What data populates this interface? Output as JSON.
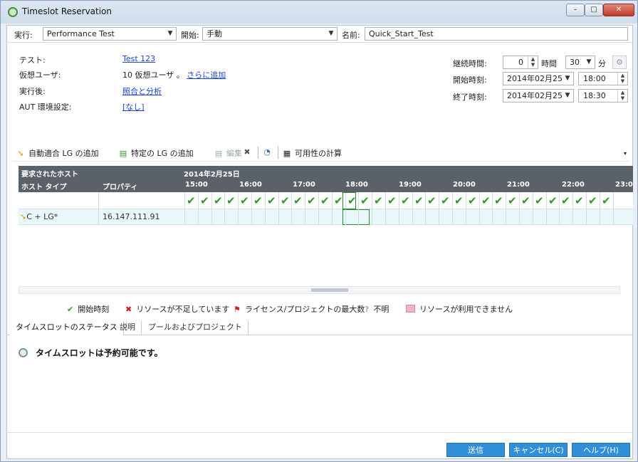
{
  "window": {
    "title": "Timeslot Reservation",
    "min": "–",
    "max": "□",
    "close": "✕"
  },
  "top": {
    "run_label": "実行:",
    "run_value": "Performance Test",
    "start_label": "開始:",
    "start_value": "手動",
    "name_label": "名前:",
    "name_value": "Quick_Start_Test"
  },
  "info": {
    "test_label": "テスト:",
    "test_value": "Test 123",
    "vusers_label": "仮想ユーザ:",
    "vusers_value": "10 仮想ユーザ 。",
    "vusers_link": "さらに追加",
    "after_label": "実行後:",
    "after_value": "照合と分析",
    "aut_label": "AUT 環境設定:",
    "aut_value": "[なし]"
  },
  "timing": {
    "duration_label": "継続時間:",
    "hours_value": "0",
    "hours_unit": "時間",
    "minutes_value": "30",
    "minutes_unit": "分",
    "start_label": "開始時刻:",
    "start_date": "2014年02月25",
    "start_time": "18:00",
    "end_label": "終了時刻:",
    "end_date": "2014年02月25",
    "end_time": "18:30"
  },
  "toolbar": {
    "auto_lg": "自動適合 LG の追加",
    "specific_lg": "特定の LG の追加",
    "edit": "編集",
    "calc": "可用性の計算"
  },
  "grid": {
    "requested_hosts": "要求されたホスト",
    "date": "2014年2月25日",
    "host_type": "ホスト タイプ",
    "properties": "プロパティ",
    "times": [
      "15:00",
      "16:00",
      "17:00",
      "18:00",
      "19:00",
      "20:00",
      "21:00",
      "22:00",
      "23:0"
    ],
    "host_name": "C + LG*",
    "host_ip": "16.147.111.91",
    "check": "✔"
  },
  "legend": {
    "start": "開始時刻",
    "lack": "リソースが不足しています",
    "license": "ライセンス/プロジェクトの最大数",
    "unknown": "不明",
    "unavailable": "リソースが利用できません"
  },
  "tabs": [
    "タイムスロットのステータス",
    "説明",
    "プールおよびプロジェクト"
  ],
  "status": {
    "message": "タイムスロットは予約可能です。"
  },
  "buttons": {
    "submit": "送信",
    "cancel": "キャンセル(C)",
    "help": "ヘルプ(H)"
  },
  "colors": {
    "accent_button": "#2f8fd8",
    "grid_header": "#5b6169",
    "check_green": "#2f9a2a",
    "host_row": "#e8f7fa"
  }
}
